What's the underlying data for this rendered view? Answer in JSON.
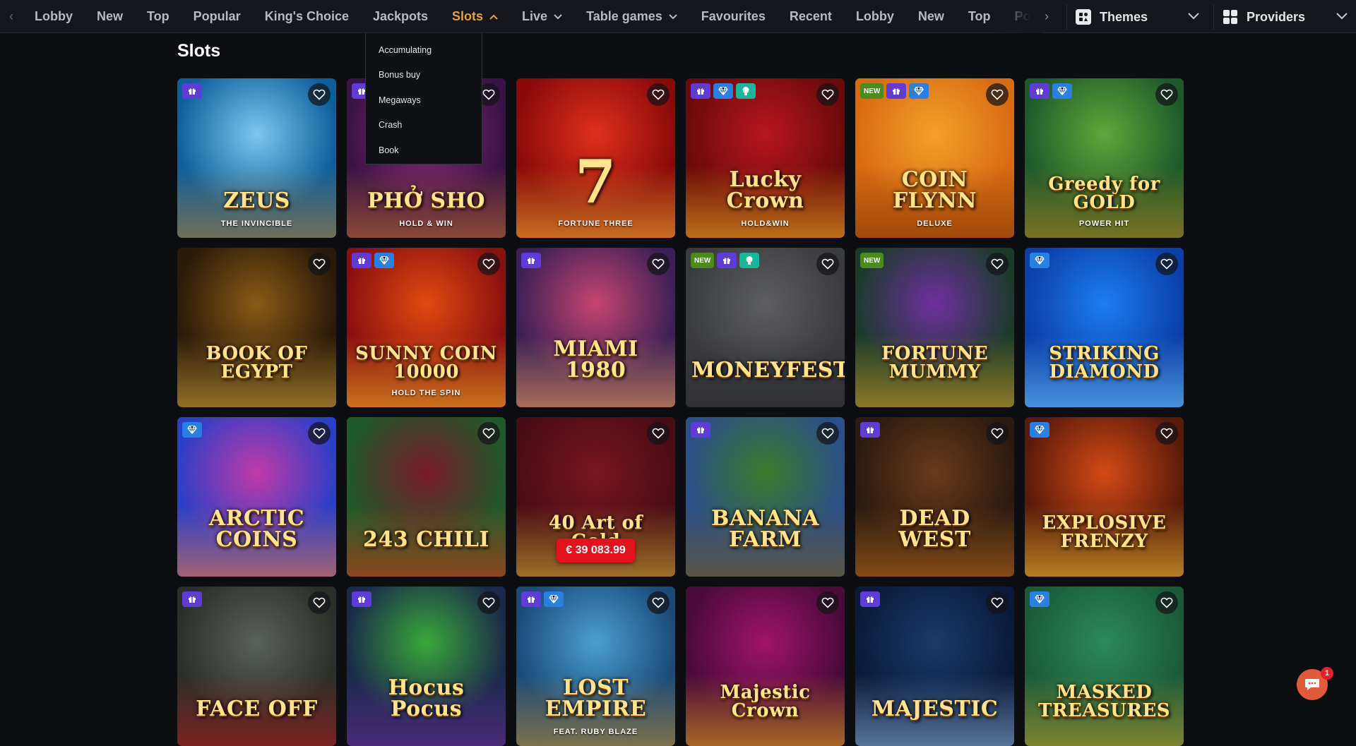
{
  "nav": {
    "items": [
      {
        "label": "Lobby",
        "name": "nav-lobby"
      },
      {
        "label": "New",
        "name": "nav-new"
      },
      {
        "label": "Top",
        "name": "nav-top"
      },
      {
        "label": "Popular",
        "name": "nav-popular"
      },
      {
        "label": "King's Choice",
        "name": "nav-kings-choice"
      },
      {
        "label": "Jackpots",
        "name": "nav-jackpots"
      },
      {
        "label": "Slots",
        "name": "nav-slots",
        "active": true,
        "caret": "up"
      },
      {
        "label": "Live",
        "name": "nav-live",
        "caret": "down"
      },
      {
        "label": "Table games",
        "name": "nav-table-games",
        "caret": "down"
      },
      {
        "label": "Favourites",
        "name": "nav-favourites"
      },
      {
        "label": "Recent",
        "name": "nav-recent"
      },
      {
        "label": "Lobby",
        "name": "nav-lobby-2"
      },
      {
        "label": "New",
        "name": "nav-new-2"
      },
      {
        "label": "Top",
        "name": "nav-top-2"
      },
      {
        "label": "Popular",
        "name": "nav-popular-2"
      }
    ],
    "themes_label": "Themes",
    "providers_label": "Providers",
    "active_color": "#e7a33b"
  },
  "slots_dropdown": {
    "items": [
      "Accumulating",
      "Bonus buy",
      "Megaways",
      "Crash",
      "Book"
    ]
  },
  "page_title": "Slots",
  "games": [
    {
      "title": "ZEUS",
      "sub": "THE INVINCIBLE",
      "badges": [
        "gift"
      ],
      "bg": [
        "#0d5f9c",
        "#7bc8ef",
        "#b2782a"
      ]
    },
    {
      "title": "PHỞ SHO",
      "sub": "HOLD & WIN",
      "badges": [
        "gift"
      ],
      "bg": [
        "#3a1245",
        "#8a2a7a",
        "#c06d2c"
      ]
    },
    {
      "title": "7",
      "sub": "FORTUNE THREE",
      "badges": [],
      "bg": [
        "#8a0a0a",
        "#e0301a",
        "#f0b030"
      ]
    },
    {
      "title": "Lucky Crown",
      "sub": "HOLD&WIN",
      "badges": [
        "gift",
        "diamond",
        "bulb"
      ],
      "bg": [
        "#6b0a0a",
        "#b8161e",
        "#f2b320"
      ]
    },
    {
      "title": "COIN FLYNN",
      "sub": "DELUXE",
      "badges": [
        "new",
        "gift",
        "diamond"
      ],
      "bg": [
        "#d86a12",
        "#f3a12a",
        "#7a3406"
      ]
    },
    {
      "title": "Greedy for GOLD",
      "sub": "POWER HIT",
      "badges": [
        "gift",
        "diamond"
      ],
      "bg": [
        "#1d5a2a",
        "#5fa83a",
        "#b7821f"
      ]
    },
    {
      "title": "BOOK OF EGYPT",
      "sub": "",
      "badges": [],
      "bg": [
        "#2a1a08",
        "#8a5a16",
        "#d9a63b"
      ]
    },
    {
      "title": "SUNNY COIN 10000",
      "sub": "HOLD THE SPIN",
      "badges": [
        "gift",
        "diamond"
      ],
      "bg": [
        "#8a1010",
        "#e24a10",
        "#f7b225"
      ]
    },
    {
      "title": "MIAMI 1980",
      "sub": "",
      "badges": [
        "gift"
      ],
      "bg": [
        "#3c1f57",
        "#c6456e",
        "#f0a05a"
      ]
    },
    {
      "title": "MONEYFEST",
      "sub": "",
      "badges": [
        "new",
        "gift",
        "bulb"
      ],
      "bg": [
        "#3a3b3d",
        "#5d5e60",
        "#2a2b2d"
      ]
    },
    {
      "title": "FORTUNE MUMMY",
      "sub": "",
      "badges": [
        "new"
      ],
      "bg": [
        "#1a3b2a",
        "#6f2fa0",
        "#d9a225"
      ]
    },
    {
      "title": "STRIKING DIAMOND",
      "sub": "",
      "badges": [
        "diamond"
      ],
      "bg": [
        "#0b3fa8",
        "#1c7ef2",
        "#6fc9ff"
      ]
    },
    {
      "title": "ARCTIC COINS",
      "sub": "",
      "badges": [
        "diamond"
      ],
      "bg": [
        "#2a3fc8",
        "#c23aa8",
        "#f27a3a"
      ]
    },
    {
      "title": "243 CHILI",
      "sub": "",
      "badges": [],
      "bg": [
        "#1f5a2a",
        "#7a1a2a",
        "#d73a16"
      ]
    },
    {
      "title": "40 Art of Gold",
      "sub": "",
      "badges": [],
      "bg": [
        "#4a0c14",
        "#7a1620",
        "#d4af37"
      ],
      "jackpot": "€ 39 083.99"
    },
    {
      "title": "BANANA FARM",
      "sub": "",
      "badges": [
        "gift"
      ],
      "bg": [
        "#2a4f8a",
        "#3d7a2a",
        "#7a5a1a"
      ]
    },
    {
      "title": "DEAD WEST",
      "sub": "",
      "badges": [
        "gift"
      ],
      "bg": [
        "#2a1a10",
        "#6a3a1a",
        "#c06a1a"
      ]
    },
    {
      "title": "EXPLOSIVE FRENZY",
      "sub": "",
      "badges": [
        "diamond"
      ],
      "bg": [
        "#5a1a0a",
        "#d44a16",
        "#f2c030"
      ]
    },
    {
      "title": "FACE OFF",
      "sub": "",
      "badges": [
        "gift"
      ],
      "bg": [
        "#2a2f2a",
        "#5a605a",
        "#b01a1a"
      ]
    },
    {
      "title": "Hocus Pocus",
      "sub": "",
      "badges": [
        "gift"
      ],
      "bg": [
        "#1a2a4a",
        "#3aa83a",
        "#6a2a9a"
      ]
    },
    {
      "title": "LOST EMPIRE",
      "sub": "FEAT. RUBY BLAZE",
      "badges": [
        "gift",
        "diamond"
      ],
      "bg": [
        "#1a4a7a",
        "#4aa0d0",
        "#c08a2a"
      ]
    },
    {
      "title": "Majestic Crown",
      "sub": "",
      "badges": [],
      "bg": [
        "#4a0a3a",
        "#a0146a",
        "#e8a21a"
      ]
    },
    {
      "title": "MAJESTIC",
      "sub": "",
      "badges": [
        "gift"
      ],
      "bg": [
        "#0a1a3a",
        "#1a3a6a",
        "#8ab0d8"
      ]
    },
    {
      "title": "MASKED TREASURES",
      "sub": "",
      "badges": [
        "diamond"
      ],
      "bg": [
        "#1a5a3a",
        "#2a8a5a",
        "#c0a02a"
      ]
    }
  ],
  "badge_labels": {
    "new": "NEW"
  },
  "chat": {
    "count": "1"
  }
}
